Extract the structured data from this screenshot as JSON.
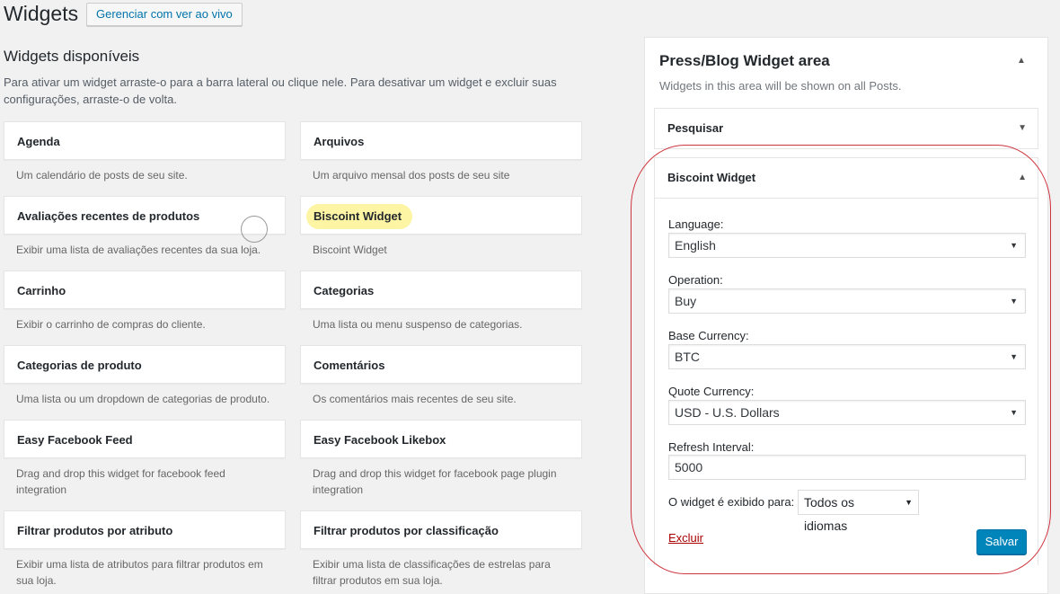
{
  "header": {
    "title": "Widgets",
    "live_button": "Gerenciar com ver ao vivo"
  },
  "available": {
    "title": "Widgets disponíveis",
    "description": "Para ativar um widget arraste-o para a barra lateral ou clique nele. Para desativar um widget e excluir suas configurações, arraste-o de volta."
  },
  "left_widgets": [
    {
      "name": "Agenda",
      "desc": "Um calendário de posts de seu site."
    },
    {
      "name": "Avaliações recentes de produtos",
      "desc": "Exibir uma lista de avaliações recentes da sua loja."
    },
    {
      "name": "Carrinho",
      "desc": "Exibir o carrinho de compras do cliente."
    },
    {
      "name": "Categorias de produto",
      "desc": "Uma lista ou um dropdown de categorias de produto."
    },
    {
      "name": "Easy Facebook Feed",
      "desc": "Drag and drop this widget for facebook feed integration"
    },
    {
      "name": "Filtrar produtos por atributo",
      "desc": "Exibir uma lista de atributos para filtrar produtos em sua loja."
    }
  ],
  "right_widgets": [
    {
      "name": "Arquivos",
      "desc": "Um arquivo mensal dos posts de seu site"
    },
    {
      "name": "Biscoint Widget",
      "desc": "Biscoint Widget"
    },
    {
      "name": "Categorias",
      "desc": "Uma lista ou menu suspenso de categorias."
    },
    {
      "name": "Comentários",
      "desc": "Os comentários mais recentes de seu site."
    },
    {
      "name": "Easy Facebook Likebox",
      "desc": "Drag and drop this widget for facebook page plugin integration"
    },
    {
      "name": "Filtrar produtos por classificação",
      "desc": "Exibir uma lista de classificações de estrelas para filtrar produtos em sua loja."
    }
  ],
  "sidebar": {
    "title": "Press/Blog Widget area",
    "description": "Widgets in this area will be shown on all Posts.",
    "search_widget": "Pesquisar",
    "biscoint": {
      "title": "Biscoint Widget",
      "language_label": "Language:",
      "language_value": "English",
      "operation_label": "Operation:",
      "operation_value": "Buy",
      "base_label": "Base Currency:",
      "base_value": "BTC",
      "quote_label": "Quote Currency:",
      "quote_value": "USD - U.S. Dollars",
      "refresh_label": "Refresh Interval:",
      "refresh_value": "5000",
      "shown_label": "O widget é exibido para:",
      "shown_value": "Todos os idiomas",
      "delete_link": "Excluir",
      "save_button": "Salvar"
    }
  },
  "colors": {
    "link": "#0073aa",
    "primary_button": "#0085ba",
    "highlight": "#fdf5a4",
    "annotation": "#d0343f",
    "delete": "#aa0000"
  }
}
